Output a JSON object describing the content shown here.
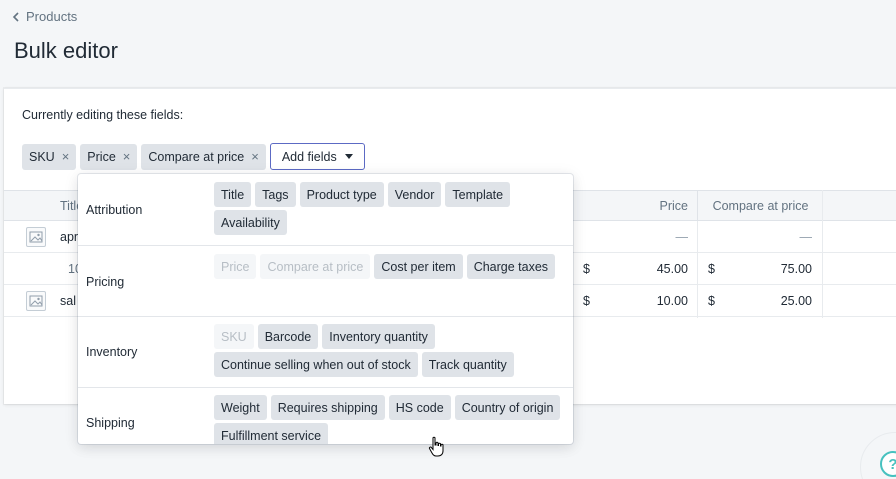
{
  "breadcrumb": {
    "label": "Products"
  },
  "page": {
    "title": "Bulk editor"
  },
  "editing": {
    "label": "Currently editing these fields:",
    "fields": [
      "SKU",
      "Price",
      "Compare at price"
    ],
    "remove_glyph": "×",
    "add_fields_label": "Add fields"
  },
  "table": {
    "headers": {
      "title": "Title",
      "price": "Price",
      "compare": "Compare at price"
    },
    "rows": [
      {
        "title": "apr",
        "price_currency": "",
        "price": "—",
        "compare_currency": "",
        "compare": "—"
      },
      {
        "title": "10",
        "price_currency": "$",
        "price": "45.00",
        "compare_currency": "$",
        "compare": "75.00"
      },
      {
        "title": "sal",
        "price_currency": "$",
        "price": "10.00",
        "compare_currency": "$",
        "compare": "25.00"
      }
    ]
  },
  "dropdown": {
    "sections": [
      {
        "label": "Attribution",
        "chips": [
          {
            "label": "Title",
            "disabled": false
          },
          {
            "label": "Tags",
            "disabled": false
          },
          {
            "label": "Product type",
            "disabled": false
          },
          {
            "label": "Vendor",
            "disabled": false
          },
          {
            "label": "Template",
            "disabled": false
          },
          {
            "label": "Availability",
            "disabled": false
          }
        ]
      },
      {
        "label": "Pricing",
        "chips": [
          {
            "label": "Price",
            "disabled": true
          },
          {
            "label": "Compare at price",
            "disabled": true
          },
          {
            "label": "Cost per item",
            "disabled": false
          },
          {
            "label": "Charge taxes",
            "disabled": false
          }
        ]
      },
      {
        "label": "Inventory",
        "chips": [
          {
            "label": "SKU",
            "disabled": true
          },
          {
            "label": "Barcode",
            "disabled": false
          },
          {
            "label": "Inventory quantity",
            "disabled": false
          },
          {
            "label": "Continue selling when out of stock",
            "disabled": false
          },
          {
            "label": "Track quantity",
            "disabled": false
          }
        ]
      },
      {
        "label": "Shipping",
        "chips": [
          {
            "label": "Weight",
            "disabled": false
          },
          {
            "label": "Requires shipping",
            "disabled": false
          },
          {
            "label": "HS code",
            "disabled": false
          },
          {
            "label": "Country of origin",
            "disabled": false
          },
          {
            "label": "Fulfillment service",
            "disabled": false
          }
        ]
      }
    ]
  },
  "help": {
    "glyph": "?"
  },
  "colors": {
    "accent": "#5c6ac4",
    "chip_bg": "#dfe3e8",
    "help": "#47c1bf"
  }
}
